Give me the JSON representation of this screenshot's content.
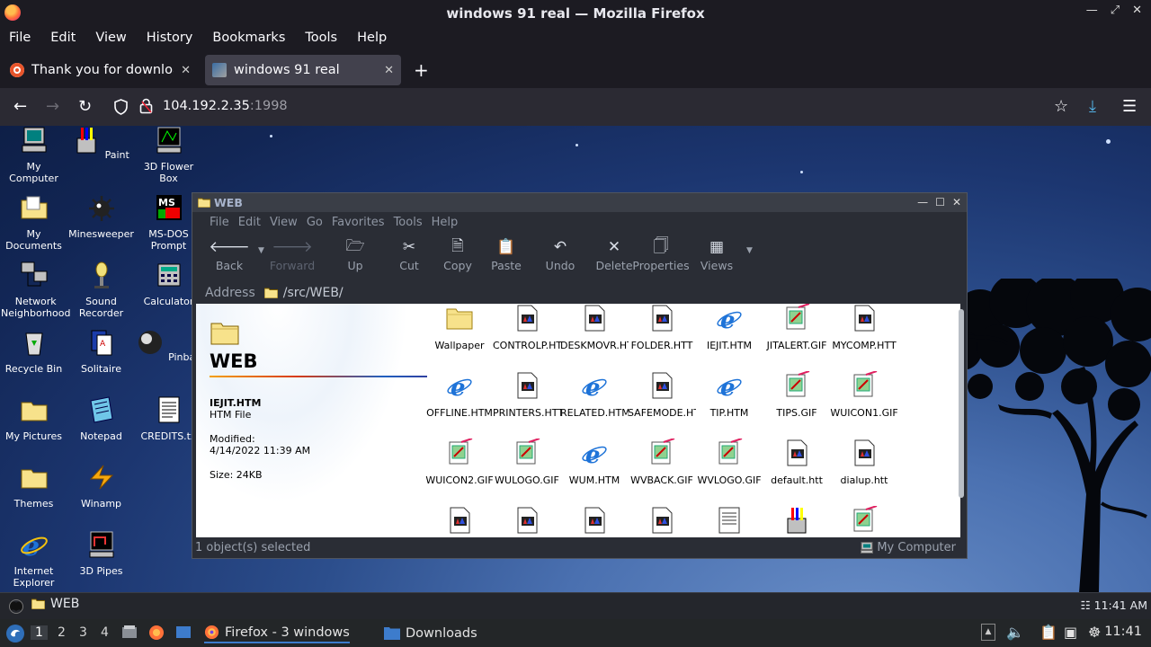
{
  "browser": {
    "window_title": "windows 91 real — Mozilla Firefox",
    "menu": [
      "File",
      "Edit",
      "View",
      "History",
      "Bookmarks",
      "Tools",
      "Help"
    ],
    "tabs": [
      {
        "label": "Thank you for downloadi",
        "active": false
      },
      {
        "label": "windows 91 real",
        "active": true
      }
    ],
    "url_host": "104.192.2.35",
    "url_port": ":1998"
  },
  "desktop": {
    "icons": [
      {
        "label": "My Computer"
      },
      {
        "label": "Paint"
      },
      {
        "label": "3D Flower Box"
      },
      {
        "label": "My Documents"
      },
      {
        "label": "Minesweeper"
      },
      {
        "label": "MS-DOS Prompt"
      },
      {
        "label": "Network Neighborhood"
      },
      {
        "label": "Sound Recorder"
      },
      {
        "label": "Calculator"
      },
      {
        "label": "Recycle Bin"
      },
      {
        "label": "Solitaire"
      },
      {
        "label": "Pinball"
      },
      {
        "label": "My Pictures"
      },
      {
        "label": "Notepad"
      },
      {
        "label": "CREDITS.tx"
      },
      {
        "label": "Themes"
      },
      {
        "label": "Winamp"
      },
      {
        "label": "Internet Explorer"
      },
      {
        "label": "3D Pipes"
      }
    ]
  },
  "explorer": {
    "title": "WEB",
    "menu": [
      "File",
      "Edit",
      "View",
      "Go",
      "Favorites",
      "Tools",
      "Help"
    ],
    "toolbar": {
      "back": "Back",
      "forward": "Forward",
      "up": "Up",
      "cut": "Cut",
      "copy": "Copy",
      "paste": "Paste",
      "undo": "Undo",
      "delete": "Delete",
      "properties": "Properties",
      "views": "Views"
    },
    "address_label": "Address",
    "address_value": "/src/WEB/",
    "panel": {
      "folder_title": "WEB",
      "selected_name": "IEJIT.HTM",
      "selected_type": "HTM File",
      "modified_label": "Modified:",
      "modified_value": "4/14/2022 11:39 AM",
      "size_label": "Size: 24KB"
    },
    "files": [
      {
        "name": "Wallpaper",
        "kind": "folder"
      },
      {
        "name": "CONTROLP.HTT",
        "kind": "htt"
      },
      {
        "name": "DESKMOVR.HTT",
        "kind": "htt"
      },
      {
        "name": "FOLDER.HTT",
        "kind": "htt"
      },
      {
        "name": "IEJIT.HTM",
        "kind": "ie"
      },
      {
        "name": "JITALERT.GIF",
        "kind": "gif"
      },
      {
        "name": "MYCOMP.HTT",
        "kind": "htt"
      },
      {
        "name": "OFFLINE.HTM",
        "kind": "ie"
      },
      {
        "name": "PRINTERS.HTT",
        "kind": "htt"
      },
      {
        "name": "RELATED.HTM",
        "kind": "ie"
      },
      {
        "name": "SAFEMODE.HTT",
        "kind": "htt"
      },
      {
        "name": "TIP.HTM",
        "kind": "ie"
      },
      {
        "name": "TIPS.GIF",
        "kind": "gif"
      },
      {
        "name": "WUICON1.GIF",
        "kind": "gif"
      },
      {
        "name": "WUICON2.GIF",
        "kind": "gif"
      },
      {
        "name": "WULOGO.GIF",
        "kind": "gif"
      },
      {
        "name": "WUM.HTM",
        "kind": "ie"
      },
      {
        "name": "WVBACK.GIF",
        "kind": "gif"
      },
      {
        "name": "WVLOGO.GIF",
        "kind": "gif"
      },
      {
        "name": "default.htt",
        "kind": "htt"
      },
      {
        "name": "dialup.htt",
        "kind": "htt"
      },
      {
        "name": "",
        "kind": "htt"
      },
      {
        "name": "",
        "kind": "htt"
      },
      {
        "name": "",
        "kind": "htt"
      },
      {
        "name": "",
        "kind": "htt"
      },
      {
        "name": "",
        "kind": "txt"
      },
      {
        "name": "",
        "kind": "paint"
      },
      {
        "name": "",
        "kind": "gif"
      }
    ],
    "status_left": "1 object(s) selected",
    "status_right": "My Computer"
  },
  "win_taskbar": {
    "task_label": "WEB",
    "clock": "11:41 AM"
  },
  "host_panel": {
    "workspaces": [
      "1",
      "2",
      "3",
      "4"
    ],
    "active_workspace": "1",
    "tasks": [
      {
        "label": "Firefox - 3 windows",
        "active": true
      },
      {
        "label": "Downloads",
        "active": false
      }
    ],
    "clock": "11:41"
  }
}
